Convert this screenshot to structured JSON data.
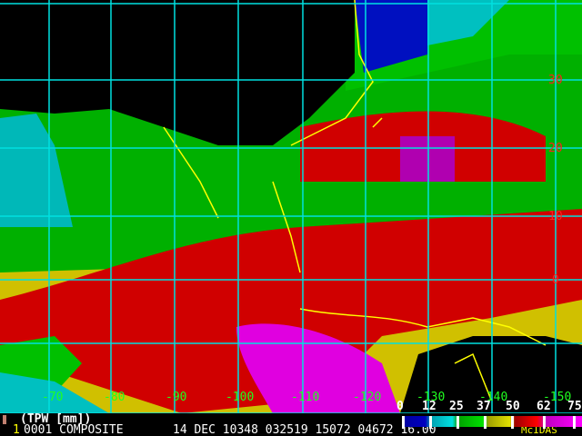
{
  "product": "(TPW [mm])",
  "frame_number": "1",
  "info_line": "0001 COMPOSITE",
  "date_line": "14 DEC 10348 032519 15072 04672 16.00",
  "brand": "McIDAS",
  "latitude_labels": [
    "30",
    "20",
    "10",
    "0"
  ],
  "longitude_labels": [
    "-70",
    "-80",
    "-90",
    "-100",
    "-110",
    "-120",
    "-130",
    "-140",
    "-150"
  ],
  "legend": {
    "labels": [
      "0",
      "12",
      "25",
      "37",
      "50",
      "62",
      "75"
    ],
    "units": "mm"
  },
  "colors": {
    "grid": "#00e0e0",
    "coast": "#ffff00",
    "lat_label": "#ff2020",
    "lon_label": "#20ff20"
  }
}
